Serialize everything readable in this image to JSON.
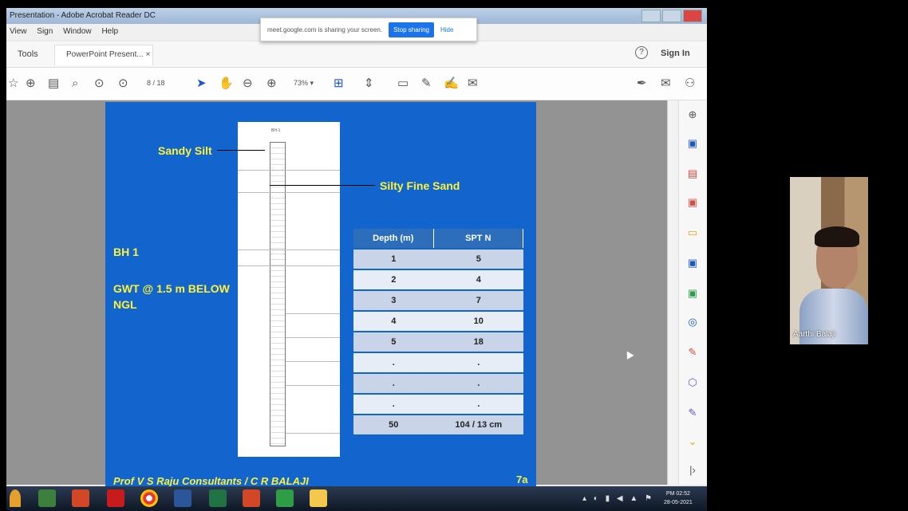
{
  "window": {
    "title": "Presentation - Adobe Acrobat Reader DC"
  },
  "menu": [
    "View",
    "Sign",
    "Window",
    "Help"
  ],
  "share_banner": {
    "message": "meet.google.com is sharing your screen.",
    "stop_label": "Stop sharing",
    "hide_label": "Hide"
  },
  "tabs": {
    "tools": "Tools",
    "document": "PowerPoint Present... ×",
    "help": "?",
    "sign_in": "Sign In"
  },
  "toolbar": {
    "page": "8 / 18",
    "zoom": "73% ▾"
  },
  "slide": {
    "label_sandy": "Sandy Silt",
    "label_silty": "Silty Fine Sand",
    "bh": "BH 1",
    "gwt": "GWT @ 1.5 m BELOW",
    "ngl": "NGL",
    "footer": "Prof V S Raju Consultants / C R BALAJI",
    "slide_number": "7a",
    "table_headers": [
      "Depth (m)",
      "SPT N"
    ],
    "table_rows": [
      [
        "1",
        "5"
      ],
      [
        "2",
        "4"
      ],
      [
        "3",
        "7"
      ],
      [
        "4",
        "10"
      ],
      [
        "5",
        "18"
      ],
      [
        ".",
        "."
      ],
      [
        ".",
        "."
      ],
      [
        ".",
        "."
      ],
      [
        "50",
        "104 / 13 cm"
      ]
    ]
  },
  "taskbar": {
    "clock_time": "PM 02:52",
    "clock_date": "28-05-2021"
  },
  "participant": {
    "name": "Aarthi Balaji"
  }
}
